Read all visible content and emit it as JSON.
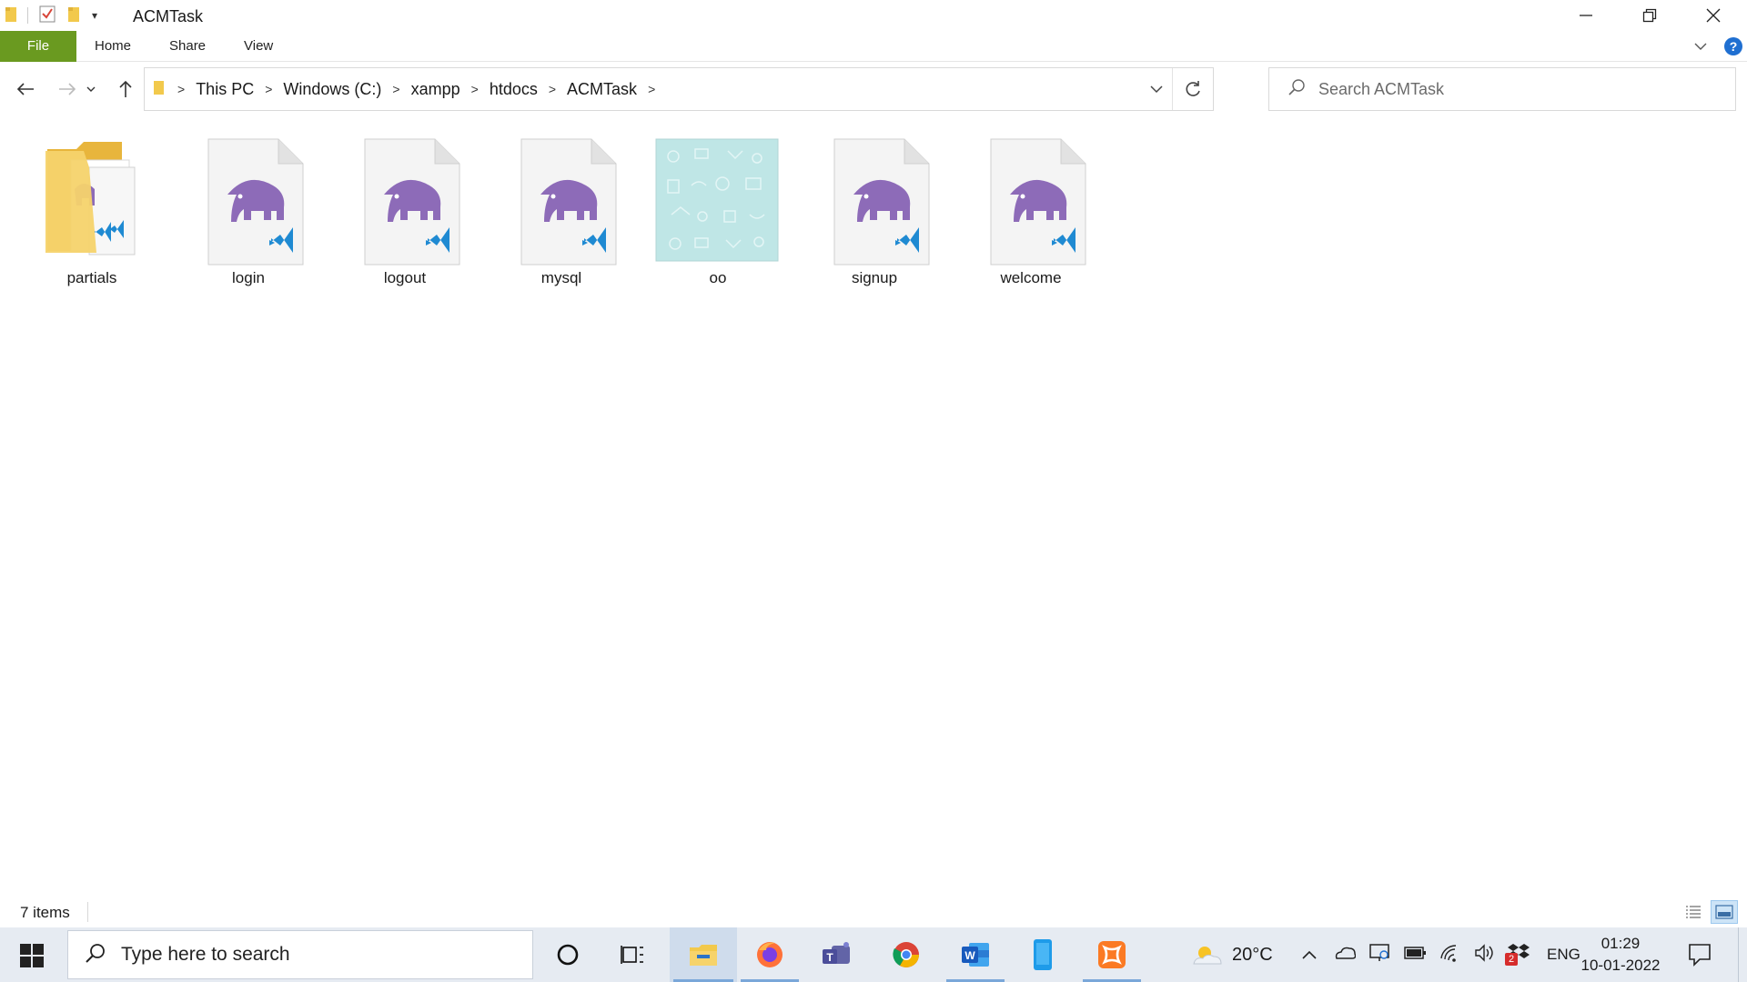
{
  "window": {
    "title": "ACMTask",
    "controls": [
      "minimize",
      "restore",
      "close"
    ]
  },
  "ribbon": {
    "tabs": [
      {
        "label": "File"
      },
      {
        "label": "Home"
      },
      {
        "label": "Share"
      },
      {
        "label": "View"
      }
    ]
  },
  "address": {
    "crumbs": [
      "This PC",
      "Windows (C:)",
      "xampp",
      "htdocs",
      "ACMTask"
    ]
  },
  "search": {
    "placeholder": "Search ACMTask"
  },
  "files": [
    {
      "name": "partials",
      "kind": "folder"
    },
    {
      "name": "login",
      "kind": "php-vscode"
    },
    {
      "name": "logout",
      "kind": "php-vscode"
    },
    {
      "name": "mysql",
      "kind": "php-vscode"
    },
    {
      "name": "oo",
      "kind": "image"
    },
    {
      "name": "signup",
      "kind": "php-vscode"
    },
    {
      "name": "welcome",
      "kind": "php-vscode"
    }
  ],
  "status": {
    "item_count": "7 items"
  },
  "taskbar": {
    "search_text": "Type here to search",
    "pinned": [
      "cortana-icon",
      "task-view-icon",
      "file-explorer-icon",
      "firefox-icon",
      "teams-icon",
      "chrome-icon",
      "word-icon",
      "phone-icon",
      "xampp-icon"
    ],
    "weather": "20°C",
    "language": "ENG",
    "time": "01:29",
    "date": "10-01-2022",
    "notification_badge": "2"
  },
  "colors": {
    "file_tab": "#6a9a20",
    "php_elephant": "#8d6bb8",
    "vscode_blue": "#1f8ad2",
    "folder_yellow": "#f2c94c",
    "image_tile": "#bfe6e6"
  }
}
